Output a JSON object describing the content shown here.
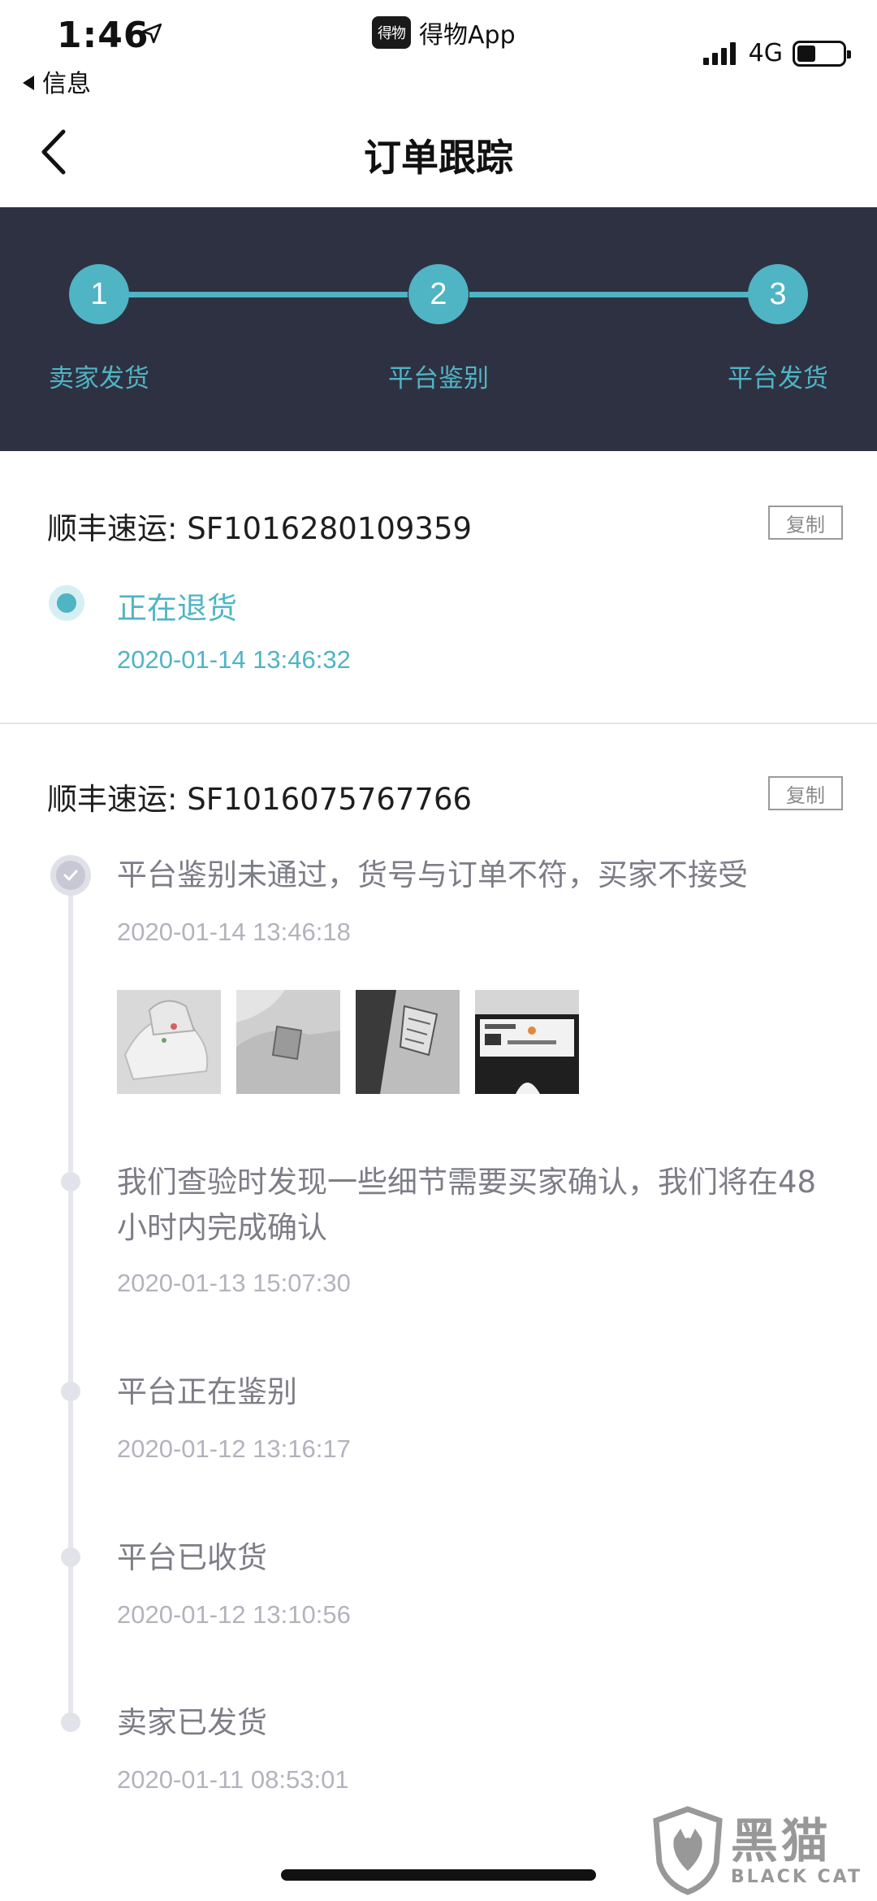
{
  "status_bar": {
    "time": "1:46",
    "back_app": "信息",
    "app_logo": "得物",
    "app_name": "得物App",
    "network": "4G",
    "icons": [
      "location-arrow-icon",
      "signal-bars-icon",
      "battery-icon"
    ],
    "battery_level": 0.4
  },
  "nav": {
    "title": "订单跟踪",
    "back_icon": "chevron-left-icon"
  },
  "steps": [
    {
      "number": "1",
      "label": "卖家发货"
    },
    {
      "number": "2",
      "label": "平台鉴别"
    },
    {
      "number": "3",
      "label": "平台发货"
    }
  ],
  "shipment_return": {
    "carrier_line": "顺丰速运: SF1016280109359",
    "copy_label": "复制",
    "event": {
      "title": "正在退货",
      "time": "2020-01-14 13:46:32"
    }
  },
  "shipment_inbound": {
    "carrier_line": "顺丰速运: SF1016075767766",
    "copy_label": "复制",
    "events": [
      {
        "title": "平台鉴别未通过，货号与订单不符，买家不接受",
        "time": "2020-01-14 13:46:18"
      },
      {
        "title": "我们查验时发现一些细节需要买家确认，我们将在48小时内完成确认",
        "time": "2020-01-13 15:07:30"
      },
      {
        "title": "平台正在鉴别",
        "time": "2020-01-12 13:16:17"
      },
      {
        "title": "平台已收货",
        "time": "2020-01-12 13:10:56"
      },
      {
        "title": "卖家已发货",
        "time": "2020-01-11 08:53:01"
      }
    ],
    "photo_count": 4
  },
  "watermark": {
    "cn": "黑猫",
    "en": "BLACK CAT"
  },
  "colors": {
    "accent": "#4fb4c4",
    "header_bg": "#2e3142",
    "muted_text": "#7d7d87",
    "time_text": "#b3b3bd"
  }
}
